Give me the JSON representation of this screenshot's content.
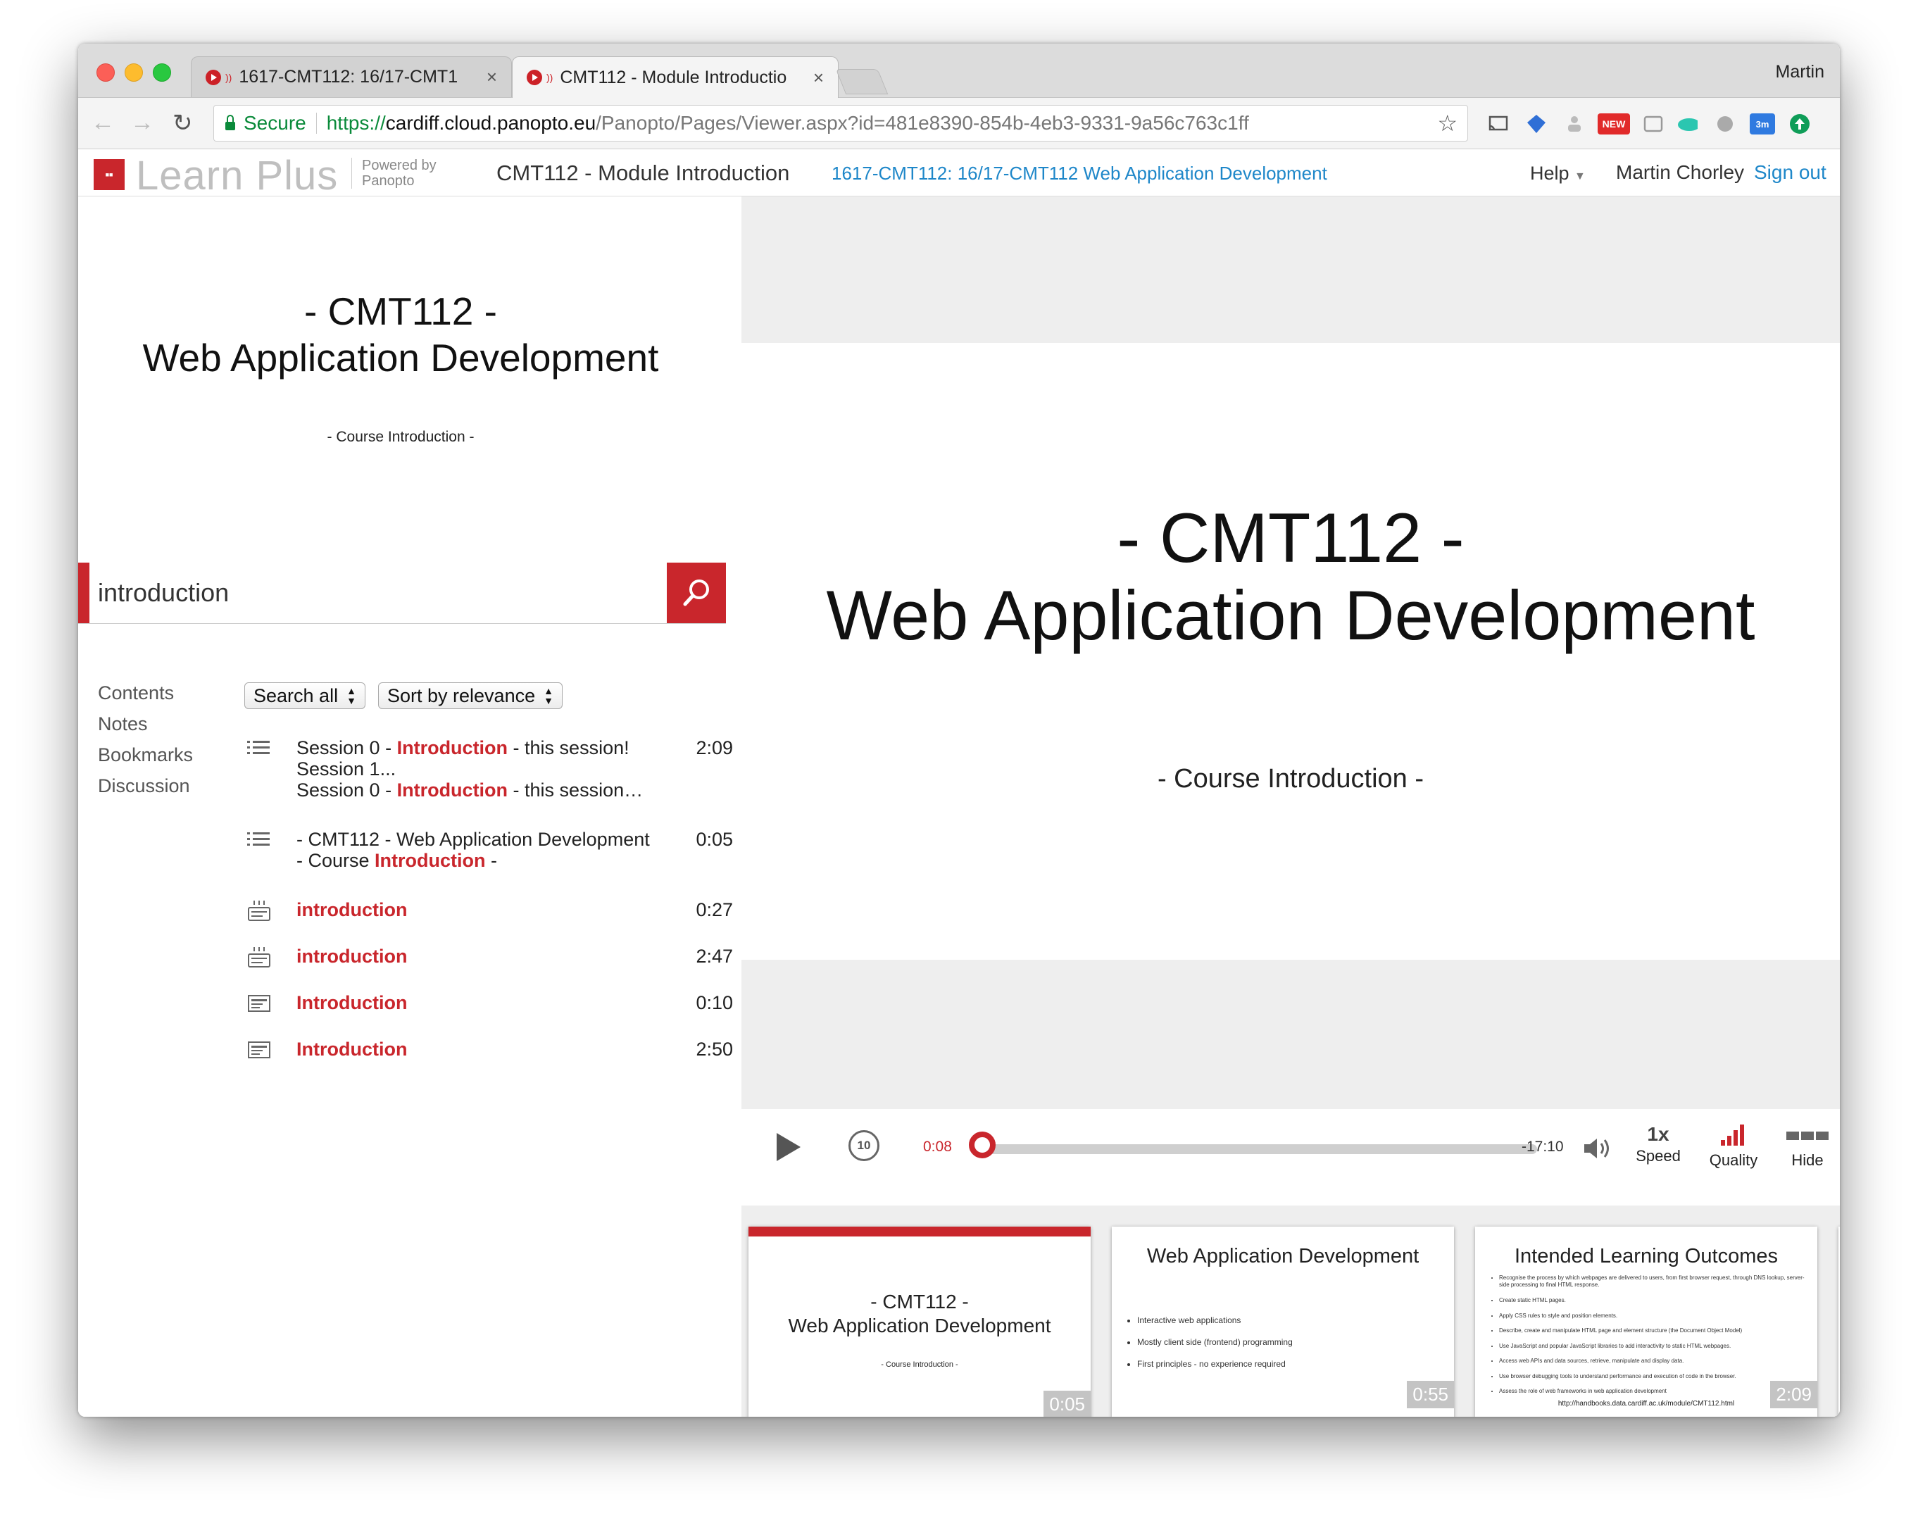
{
  "browser": {
    "tabs": [
      {
        "title": "1617-CMT112: 16/17-CMT1",
        "active": false
      },
      {
        "title": "CMT112 - Module Introductio",
        "active": true
      }
    ],
    "profile_name": "Martin",
    "secure_label": "Secure",
    "url_scheme": "https://",
    "url_host": "cardiff.cloud.panopto.eu",
    "url_path": "/Panopto/Pages/Viewer.aspx?id=481e8390-854b-4eb3-9331-9a56c763c1ff",
    "extensions": {
      "new_badge": "NEW",
      "timer_badge": "3m"
    }
  },
  "header": {
    "logo_text": "Learn Plus",
    "powered_by": "Powered by",
    "powered_brand": "Panopto",
    "session_title": "CMT112 - Module Introduction",
    "folder_link": "1617-CMT112: 16/17-CMT112 Web Application Development",
    "help_label": "Help",
    "user_name": "Martin Chorley",
    "sign_out": "Sign out"
  },
  "secondary_slide": {
    "title_line1": "- CMT112 -",
    "title_line2": "Web Application Development",
    "subtitle": "- Course Introduction -"
  },
  "search": {
    "value": "introduction"
  },
  "sidenav": {
    "contents": "Contents",
    "notes": "Notes",
    "bookmarks": "Bookmarks",
    "discussion": "Discussion"
  },
  "filters": {
    "search_scope": "Search all",
    "sort": "Sort by relevance"
  },
  "results": [
    {
      "icon": "list-icon",
      "lines": [
        [
          "Session 0 - ",
          "Introduction",
          " - this session!"
        ],
        [
          "Session 1...",
          "",
          ""
        ],
        [
          "Session 0 - ",
          "Introduction",
          " - this session…"
        ]
      ],
      "time": "2:09"
    },
    {
      "icon": "list-icon",
      "lines": [
        [
          "- CMT112 - Web Application Development",
          "",
          ""
        ],
        [
          "- Course ",
          "Introduction",
          " -"
        ]
      ],
      "time": "0:05"
    },
    {
      "icon": "captions-icon",
      "lines": [
        [
          "",
          "introduction",
          ""
        ]
      ],
      "time": "0:27"
    },
    {
      "icon": "captions-icon",
      "lines": [
        [
          "",
          "introduction",
          ""
        ]
      ],
      "time": "2:47"
    },
    {
      "icon": "slide-icon",
      "lines": [
        [
          "",
          "Introduction",
          ""
        ]
      ],
      "time": "0:10"
    },
    {
      "icon": "slide-icon",
      "lines": [
        [
          "",
          "Introduction",
          ""
        ]
      ],
      "time": "2:50"
    }
  ],
  "primary_slide": {
    "title_line1": "- CMT112 -",
    "title_line2": "Web Application Development",
    "subtitle": "- Course Introduction -"
  },
  "player": {
    "current_time": "0:08",
    "remaining_time": "-17:10",
    "progress_fraction": 0.008,
    "rewind_label": "10",
    "speed_value": "1x",
    "speed_label": "Speed",
    "quality_label": "Quality",
    "hide_label": "Hide",
    "accent_color": "#c9262c"
  },
  "thumbnails": [
    {
      "title_line1": "- CMT112 -",
      "title_line2": "Web Application Development",
      "subtitle": "- Course Introduction -",
      "duration": "0:05",
      "active": true
    },
    {
      "title": "Web Application Development",
      "bullets": [
        "Interactive web applications",
        "Mostly client side (frontend) programming",
        "First principles - no experience required"
      ],
      "duration": "0:55"
    },
    {
      "title": "Intended Learning Outcomes",
      "bullets": [
        "Recognise the process by which webpages are delivered to users, from first browser request, through DNS lookup, server-side processing to final HTML response.",
        "Create static HTML pages.",
        "Apply CSS rules to style and position elements.",
        "Describe, create and manipulate HTML page and element structure (the Document Object Model)",
        "Use JavaScript and popular JavaScript libraries to add interactivity to static HTML webpages.",
        "Access web APIs and data sources, retrieve, manipulate and display data.",
        "Use browser debugging tools to understand performance and execution of code in the browser.",
        "Assess the role of web frameworks in web application development"
      ],
      "footer": "http://handbooks.data.cardiff.ac.uk/module/CMT112.html",
      "duration": "2:09"
    }
  ]
}
